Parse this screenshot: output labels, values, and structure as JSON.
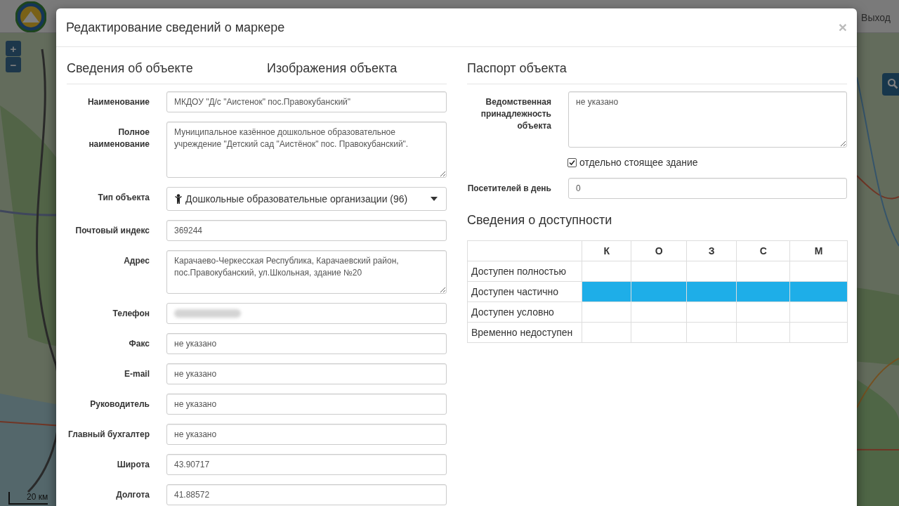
{
  "header": {
    "exit_link": "Выход"
  },
  "map_controls": {
    "zoom_in": "+",
    "zoom_out": "−",
    "scale": "20 км"
  },
  "dialog": {
    "title": "Редактирование сведений о маркере",
    "close": "×",
    "left_sections": [
      "Сведения об объекте",
      "Изображения объекта"
    ],
    "fields": [
      {
        "kind": "input",
        "label": "Наименование",
        "value": "МКДОУ \"Д/с \"Аистенок\" пос.Правокубанский\""
      },
      {
        "kind": "textarea",
        "label": "Полное наименование",
        "value": "Муниципальное казённое дошкольное образовательное учреждение \"Детский сад \"Аистёнок\" пос. Правокубанский\"."
      },
      {
        "kind": "select",
        "label": "Тип объекта",
        "value": "Дошкольные образовательные организации (96)"
      },
      {
        "kind": "input",
        "label": "Почтовый индекс",
        "value": "369244"
      },
      {
        "kind": "textarea-short",
        "label": "Адрес",
        "value": "Карачаево-Черкесская Республика, Карачаевский район, пос.Правокубанский, ул.Школьная, здание №20"
      },
      {
        "kind": "redacted",
        "label": "Телефон"
      },
      {
        "kind": "input",
        "label": "Факс",
        "value": "не указано"
      },
      {
        "kind": "input",
        "label": "E-mail",
        "value": "не указано"
      },
      {
        "kind": "input",
        "label": "Руководитель",
        "value": "не указано"
      },
      {
        "kind": "input",
        "label": "Главный бухгалтер",
        "value": "не указано"
      },
      {
        "kind": "input",
        "label": "Широта",
        "value": "43.90717"
      },
      {
        "kind": "input",
        "label": "Долгота",
        "value": "41.88572"
      }
    ],
    "passport": {
      "title": "Паспорт объекта",
      "department": {
        "label": "Ведомственная принадлежность объекта",
        "value": "не указано"
      },
      "standalone": {
        "label": "отдельно стоящее здание",
        "checked": true
      },
      "visitors": {
        "label": "Посетителей в день",
        "value": "0"
      }
    },
    "accessibility": {
      "title": "Сведения о доступности",
      "columns": [
        "К",
        "О",
        "З",
        "С",
        "М"
      ],
      "rows": [
        {
          "label": "Доступен полностью",
          "cells": [
            false,
            false,
            false,
            false,
            false
          ]
        },
        {
          "label": "Доступен частично",
          "cells": [
            true,
            true,
            true,
            true,
            true
          ]
        },
        {
          "label": "Доступен условно",
          "cells": [
            false,
            false,
            false,
            false,
            false
          ]
        },
        {
          "label": "Временно недоступен",
          "cells": [
            false,
            false,
            false,
            false,
            false
          ]
        }
      ]
    }
  }
}
